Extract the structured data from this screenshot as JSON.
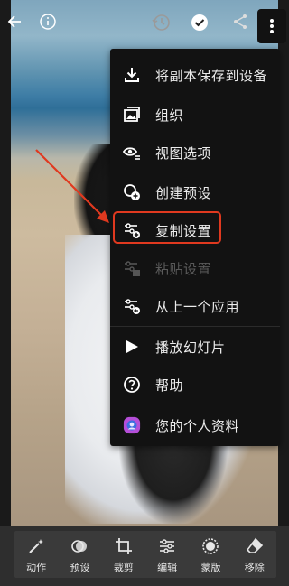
{
  "top_bar": {
    "icons": [
      "back-arrow-icon",
      "info-icon",
      "history-icon",
      "checkmark-icon",
      "share-icon",
      "more-vertical-icon"
    ]
  },
  "menu": {
    "items": [
      {
        "label": "将副本保存到设备",
        "icon": "download-icon",
        "disabled": false
      },
      {
        "label": "组织",
        "icon": "organize-icon",
        "disabled": false
      },
      {
        "label": "视图选项",
        "icon": "view-options-icon",
        "disabled": false
      },
      {
        "label": "创建预设",
        "icon": "create-preset-icon",
        "disabled": false
      },
      {
        "label": "复制设置",
        "icon": "copy-settings-icon",
        "disabled": false
      },
      {
        "label": "粘贴设置",
        "icon": "paste-settings-icon",
        "disabled": true
      },
      {
        "label": "从上一个应用",
        "icon": "apply-previous-icon",
        "disabled": false
      },
      {
        "label": "播放幻灯片",
        "icon": "play-icon",
        "disabled": false
      },
      {
        "label": "帮助",
        "icon": "help-icon",
        "disabled": false
      },
      {
        "label": "您的个人资料",
        "icon": "profile-avatar-icon",
        "disabled": false
      }
    ],
    "highlighted_item": "复制设置"
  },
  "bottom_toolbar": {
    "tools": [
      {
        "label": "动作",
        "icon": "magic-wand-icon"
      },
      {
        "label": "预设",
        "icon": "presets-icon"
      },
      {
        "label": "裁剪",
        "icon": "crop-icon"
      },
      {
        "label": "编辑",
        "icon": "sliders-icon"
      },
      {
        "label": "蒙版",
        "icon": "mask-icon"
      },
      {
        "label": "移除",
        "icon": "eraser-icon"
      }
    ]
  },
  "colors": {
    "highlight": "#e0391f",
    "menu_bg": "#121212",
    "toolbar_bg": "#3a3a3a"
  }
}
